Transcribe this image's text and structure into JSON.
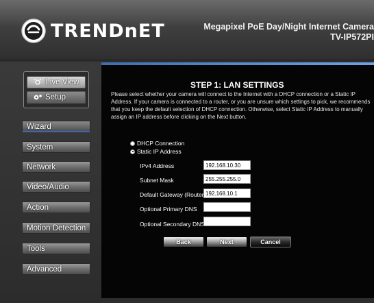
{
  "header": {
    "brand": "TRENDnET",
    "product_line1": "Megapixel PoE Day/Night Internet Camera",
    "product_line2": "TV-IP572PI"
  },
  "mode": {
    "live_view": "Live View",
    "setup": "Setup"
  },
  "sidebar": {
    "items": [
      {
        "label": "Wizard",
        "active": true
      },
      {
        "label": "System"
      },
      {
        "label": "Network"
      },
      {
        "label": "Video/Audio"
      },
      {
        "label": "Action"
      },
      {
        "label": "Motion Detection"
      },
      {
        "label": "Tools"
      },
      {
        "label": "Advanced"
      }
    ]
  },
  "main": {
    "title": "STEP 1: LAN SETTINGS",
    "description": "Please select whether your camera will connect to the Internet with a DHCP connection or a Static IP Address. If your camera is connected to a router, or you are unsure which settings to pick, we recommends that you keep the default selection of DHCP connection. Otherwise, select Static IP Address to manually assign an IP address before clicking on the Next button.",
    "radio_dhcp": "DHCP Connection",
    "radio_static": "Static IP Address",
    "selected": "static",
    "fields": {
      "ipv4_label": "IPv4 Address",
      "ipv4_value": "192.168.10.30",
      "mask_label": "Subnet Mask",
      "mask_value": "255.255.255.0",
      "gateway_label": "Default Gateway (Router)",
      "gateway_value": "192.168.10.1",
      "dns1_label": "Optional Primary DNS",
      "dns1_value": "",
      "dns2_label": "Optional Secondary DNS",
      "dns2_value": ""
    },
    "buttons": {
      "back": "Back",
      "next": "Next",
      "cancel": "Cancel"
    }
  },
  "colors": {
    "accent": "#3b67b8",
    "background": "#050505"
  }
}
